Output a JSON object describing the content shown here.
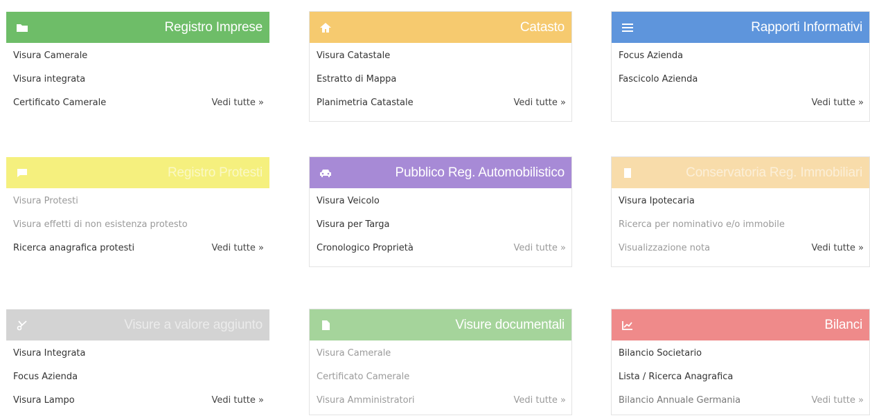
{
  "cards": [
    {
      "title": "Registro Imprese",
      "icon": "folder-icon",
      "color": "#6ebd68",
      "links": [
        "Visura Camerale",
        "Visura integrata",
        "Certificato Camerale"
      ],
      "more": "Vedi tutte »"
    },
    {
      "title": "Catasto",
      "icon": "home-icon",
      "color": "#f6ca6f",
      "links": [
        "Visura Catastale",
        "Estratto di Mappa",
        "Planimetria Catastale"
      ],
      "more": "Vedi tutte »"
    },
    {
      "title": "Rapporti Informativi",
      "icon": "list-icon",
      "color": "#5e95dc",
      "links": [
        "Focus Azienda",
        "Fascicolo Azienda"
      ],
      "more": "Vedi tutte »"
    },
    {
      "title": "Registro Protesti",
      "icon": "message-icon",
      "color": "#f5f07e",
      "links": [
        "Visura Protesti",
        "Visura effetti di non esistenza protesto",
        "Ricerca anagrafica protesti"
      ],
      "more": "Vedi tutte »"
    },
    {
      "title": "Pubblico Reg. Automobilistico",
      "icon": "car-icon",
      "color": "#a78ad6",
      "links": [
        "Visura Veicolo",
        "Visura per Targa",
        "Cronologico Proprietà"
      ],
      "more": "Vedi tutte »"
    },
    {
      "title": "Conservatoria Reg. Immobiliari",
      "icon": "building-icon",
      "color": "#f8dcaa",
      "links": [
        "Visura Ipotecaria",
        "Ricerca per nominativo e/o immobile",
        "Visualizzazione nota"
      ],
      "more": "Vedi tutte »"
    },
    {
      "title": "Visure a valore aggiunto",
      "icon": "scissors-icon",
      "color": "#d3d3d3",
      "links": [
        "Visura Integrata",
        "Focus Azienda",
        "Visura Lampo"
      ],
      "more": "Vedi tutte »"
    },
    {
      "title": "Visure documentali",
      "icon": "document-icon",
      "color": "#a5d49b",
      "links": [
        "Visura Camerale",
        "Certificato Camerale",
        "Visura Amministratori"
      ],
      "more": "Vedi tutte »"
    },
    {
      "title": "Bilanci",
      "icon": "chart-icon",
      "color": "#ef8a8a",
      "links": [
        "Bilancio Societario",
        "Lista / Ricerca Anagrafica",
        "Bilancio Annuale Germania"
      ],
      "more": "Vedi tutte »"
    }
  ]
}
